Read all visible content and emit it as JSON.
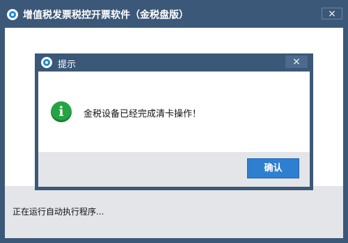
{
  "main_window": {
    "title": "增值税发票税控开票软件（金税盘版）",
    "close_label": "×",
    "status_text": "正在运行自动执行程序..."
  },
  "dialog": {
    "title": "提示",
    "close_label": "×",
    "message": "金税设备已经完成清卡操作！",
    "info_icon_glyph": "i",
    "confirm_label": "确认"
  },
  "icons": {
    "app_logo": "app-logo-icon",
    "dialog_logo": "app-logo-icon",
    "info": "info-icon"
  },
  "colors": {
    "titlebar": "#3c5878",
    "footer": "#e3e5e8",
    "primary_button": "#2f7fd0",
    "info_icon": "#27a442"
  }
}
